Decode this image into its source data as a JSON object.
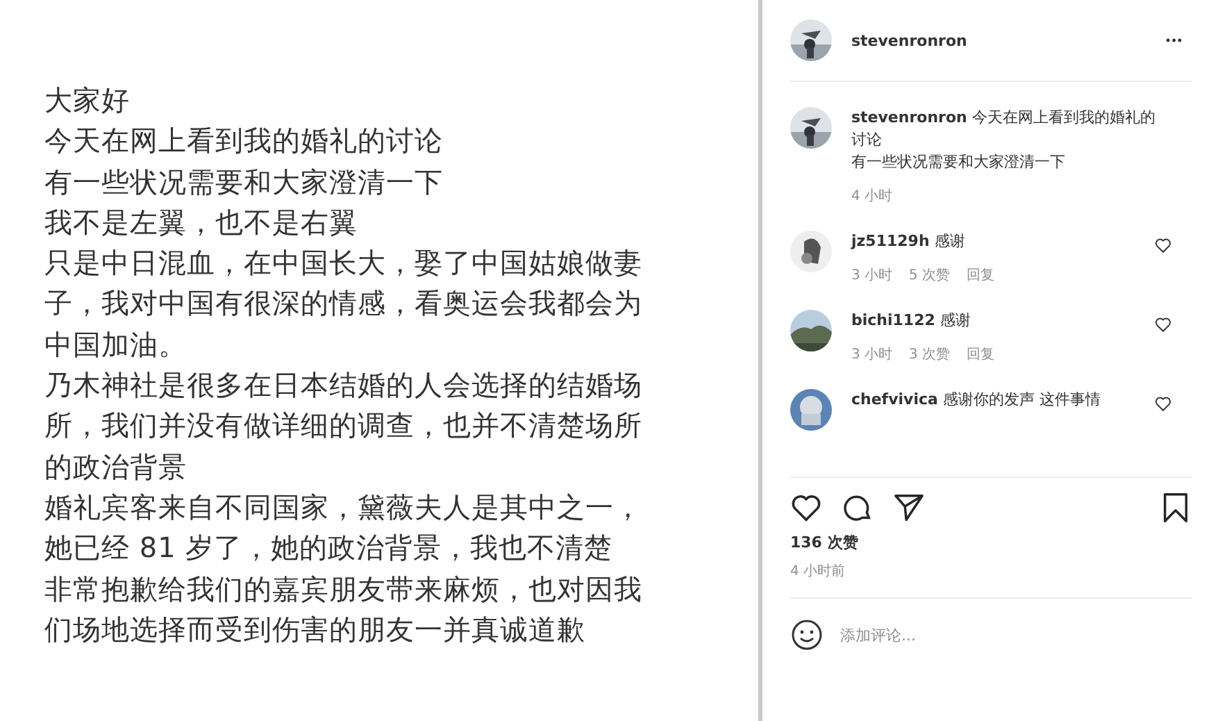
{
  "post_image": {
    "lines": [
      "大家好",
      "今天在网上看到我的婚礼的讨论",
      "有一些状况需要和大家澄清一下",
      "我不是左翼，也不是右翼",
      "只是中日混血，在中国长大，娶了中国姑娘做妻",
      "子，我对中国有很深的情感，看奥运会我都会为",
      "中国加油。",
      "乃木神社是很多在日本结婚的人会选择的结婚场",
      "所，我们并没有做详细的调查，也并不清楚场所",
      "的政治背景",
      "婚礼宾客来自不同国家，黛薇夫人是其中之一，",
      "她已经 81 岁了，她的政治背景，我也不清楚",
      "非常抱歉给我们的嘉宾朋友带来麻烦，也对因我",
      "们场地选择而受到伤害的朋友一并真诚道歉"
    ]
  },
  "header": {
    "username": "stevenronron",
    "more": "•••"
  },
  "caption": {
    "username": "stevenronron",
    "lines": [
      "今天在网上看到我的婚礼的讨论",
      "有一些状况需要和大家澄清一下"
    ],
    "time": "4 小时"
  },
  "comments": [
    {
      "username": "jz51129h",
      "text": "感谢",
      "time": "3 小时",
      "likes": "5 次赞",
      "reply": "回复",
      "liked": false
    },
    {
      "username": "bichi1122",
      "text": "感谢",
      "time": "3 小时",
      "likes": "3 次赞",
      "reply": "回复",
      "liked": false
    },
    {
      "username": "chefvivica",
      "text": "感谢你的发声 这件事情",
      "liked": false
    }
  ],
  "likes": "136 次赞",
  "posted": "4 小时前",
  "comment_field": {
    "placeholder": "添加评论..."
  }
}
